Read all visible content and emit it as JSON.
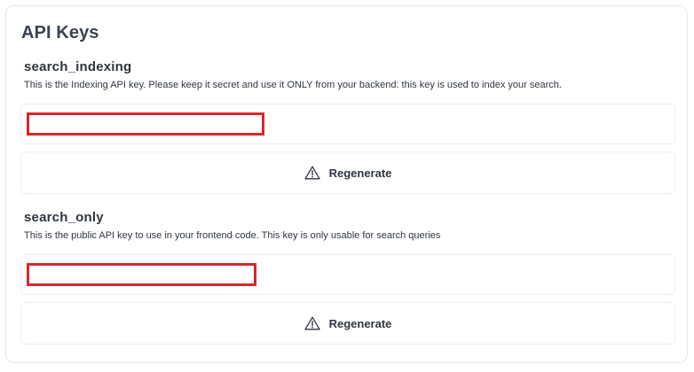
{
  "card": {
    "title": "API Keys"
  },
  "keys": [
    {
      "name": "search_indexing",
      "description": "This is the Indexing API key. Please keep it secret and use it ONLY from your backend: this key is used to index your search.",
      "value": "",
      "regenerate_label": "Regenerate",
      "regenerate_icon": "warning-icon"
    },
    {
      "name": "search_only",
      "description": "This is the public API key to use in your frontend code. This key is only usable for search queries",
      "value": "",
      "regenerate_label": "Regenerate",
      "regenerate_icon": "warning-icon"
    }
  ],
  "colors": {
    "redaction": "#d9262b",
    "border": "#eceef1",
    "text": "#2f3640"
  }
}
